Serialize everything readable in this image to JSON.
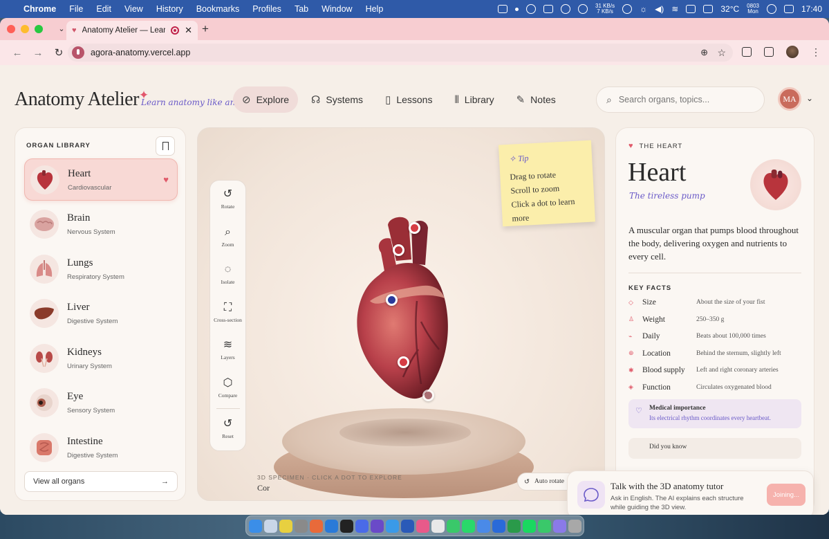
{
  "menubar": {
    "app": "Chrome",
    "items": [
      "File",
      "Edit",
      "View",
      "History",
      "Bookmarks",
      "Profiles",
      "Tab",
      "Window",
      "Help"
    ],
    "net_up": "31 KB/s",
    "net_down": "7 KB/s",
    "temperature": "32°C",
    "date_day": "0803",
    "date_weekday": "Mon",
    "time": "17:40"
  },
  "browser": {
    "tab_title": "Anatomy Atelier — Learn",
    "url": "agora-anatomy.vercel.app"
  },
  "header": {
    "brand": "Anatomy Atelier",
    "tagline": "Learn anatomy like an artist",
    "nav": [
      {
        "label": "Explore",
        "icon": "compass-icon"
      },
      {
        "label": "Systems",
        "icon": "systems-icon"
      },
      {
        "label": "Lessons",
        "icon": "book-icon"
      },
      {
        "label": "Library",
        "icon": "library-icon"
      },
      {
        "label": "Notes",
        "icon": "notes-icon"
      }
    ],
    "search_placeholder": "Search organs, topics...",
    "avatar_initials": "MA"
  },
  "library": {
    "title": "ORGAN LIBRARY",
    "organs": [
      {
        "name": "Heart",
        "system": "Cardiovascular",
        "color": "#b8343c"
      },
      {
        "name": "Brain",
        "system": "Nervous System",
        "color": "#d9a3a0"
      },
      {
        "name": "Lungs",
        "system": "Respiratory System",
        "color": "#d98b88"
      },
      {
        "name": "Liver",
        "system": "Digestive System",
        "color": "#8a3a2a"
      },
      {
        "name": "Kidneys",
        "system": "Urinary System",
        "color": "#b84a48"
      },
      {
        "name": "Eye",
        "system": "Sensory System",
        "color": "#a85a4a"
      },
      {
        "name": "Intestine",
        "system": "Digestive System",
        "color": "#d9786a"
      }
    ],
    "view_all": "View all organs"
  },
  "viewer": {
    "tools": [
      {
        "label": "Rotate",
        "icon": "rotate-icon"
      },
      {
        "label": "Zoom",
        "icon": "zoom-icon"
      },
      {
        "label": "Isolate",
        "icon": "isolate-icon"
      },
      {
        "label": "Cross-section",
        "icon": "cross-section-icon"
      },
      {
        "label": "Layers",
        "icon": "layers-icon"
      },
      {
        "label": "Compare",
        "icon": "cube-icon"
      },
      {
        "label": "Reset",
        "icon": "reset-icon"
      }
    ],
    "tip": {
      "title": "Tip",
      "lines": [
        "Drag to rotate",
        "Scroll to zoom",
        "Click a dot to learn",
        "more"
      ]
    },
    "caption": "3D SPECIMEN · CLICK A DOT TO EXPLORE",
    "specimen_name": "Cor",
    "auto_rotate": "Auto rotate"
  },
  "detail": {
    "kicker": "THE HEART",
    "title": "Heart",
    "subtitle": "The tireless pump",
    "description": "A muscular organ that pumps blood throughout the body, delivering oxygen and nutrients to every cell.",
    "facts_heading": "KEY FACTS",
    "facts": [
      {
        "label": "Size",
        "value": "About the size of your fist"
      },
      {
        "label": "Weight",
        "value": "250–350 g"
      },
      {
        "label": "Daily",
        "value": "Beats about 100,000 times"
      },
      {
        "label": "Location",
        "value": "Behind the sternum, slightly left"
      },
      {
        "label": "Blood supply",
        "value": "Left and right coronary arteries"
      },
      {
        "label": "Function",
        "value": "Circulates oxygenated blood"
      }
    ],
    "medical_title": "Medical importance",
    "medical_body": "Its electrical rhythm coordinates every heartbeat.",
    "did_you_know": "Did you know"
  },
  "tutor": {
    "title": "Talk with the 3D anatomy tutor",
    "body": "Ask in English. The AI explains each structure while guiding the 3D view.",
    "button": "Joining..."
  }
}
